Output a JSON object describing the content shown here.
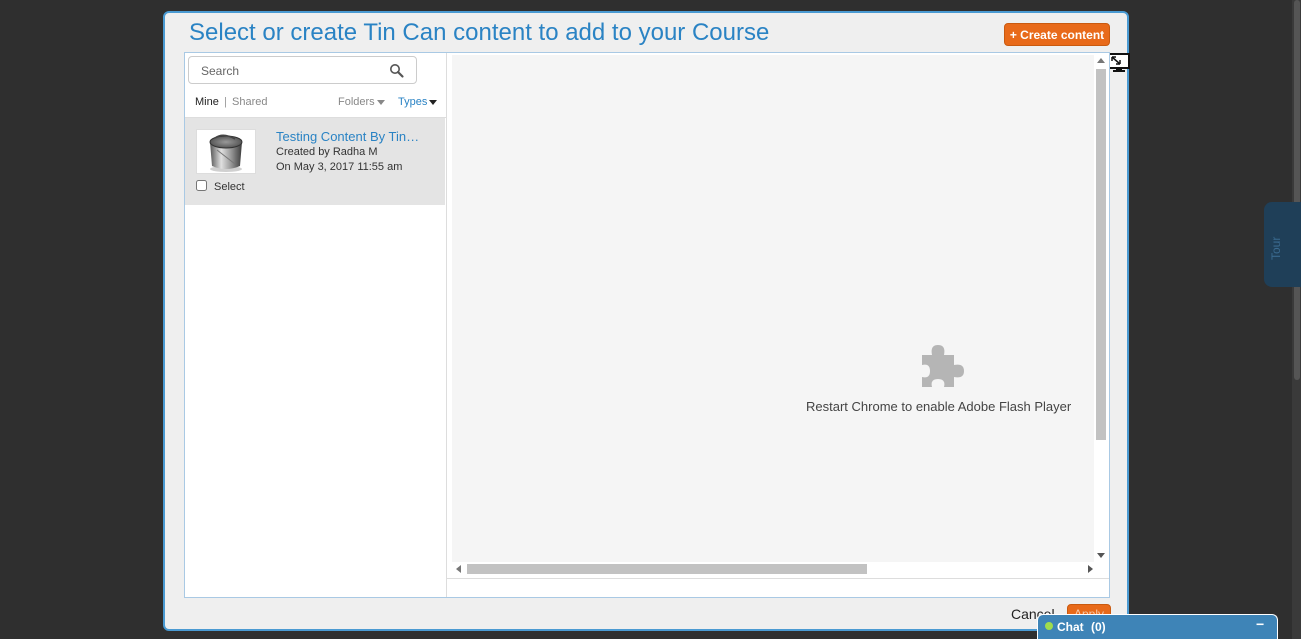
{
  "modal": {
    "title": "Select or create Tin Can content to add to your Course",
    "create_button": "+ Create content"
  },
  "search": {
    "placeholder": "Search",
    "value": ""
  },
  "filters": {
    "mine": "Mine",
    "separator": "|",
    "shared": "Shared",
    "folders": "Folders",
    "types": "Types"
  },
  "content_items": [
    {
      "title": "Testing Content By Tin…",
      "author": "Created by Radha M",
      "date": "On May 3, 2017 11:55 am",
      "select_label": "Select",
      "selected": false,
      "thumbnail_icon": "tin-can-icon"
    }
  ],
  "preview": {
    "plugin_icon": "puzzle-piece-icon",
    "message": "Restart Chrome to enable Adobe Flash Player"
  },
  "footer": {
    "cancel": "Cancel",
    "apply": "Apply"
  },
  "chat": {
    "label": "Chat",
    "count": "(0)",
    "minimize": "−",
    "status_color": "#9fdc4d"
  },
  "side_tab": {
    "label": "Tour"
  },
  "colors": {
    "accent": "#2a83c4",
    "primary_button": "#e86a1a",
    "chat_bar": "#3e84b7",
    "backdrop": "#2f2f2f"
  }
}
